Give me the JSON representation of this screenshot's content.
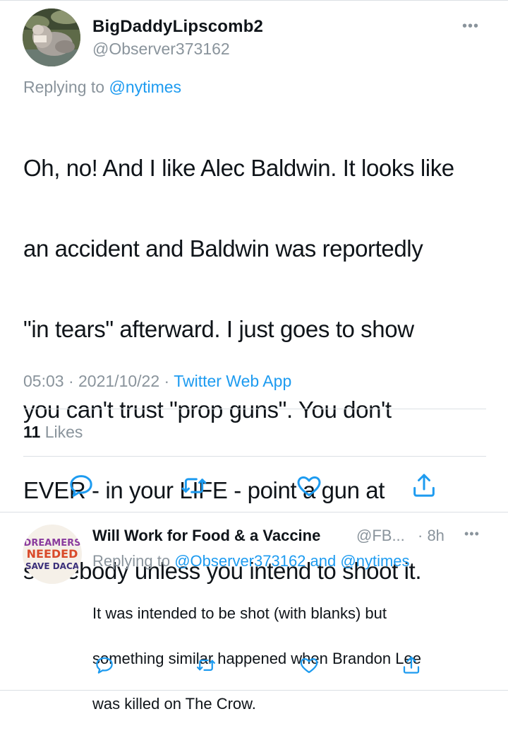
{
  "main_tweet": {
    "display_name": "BigDaddyLipscomb2",
    "handle": "@Observer373162",
    "more_icon": "more-horizontal-icon",
    "replying_prefix": "Replying to",
    "replying_to": "@nytimes",
    "body_lines": [
      "Oh, no! And I like Alec Baldwin.  It looks like",
      "an accident and Baldwin was reportedly",
      "\"in tears\" afterward.   I just goes to show",
      "you can't trust \"prop guns\". You don't",
      "EVER - in your LIFE - point a gun at",
      "somebody unless you intend to shoot it."
    ],
    "time": "05:03",
    "date": "2021/10/22",
    "source": "Twitter Web App",
    "separator": "·",
    "likes_count": "11",
    "likes_label": "Likes",
    "actions": [
      "reply-icon",
      "retweet-icon",
      "like-icon",
      "share-icon"
    ]
  },
  "reply_tweet": {
    "display_name": "Will Work for Food & a Vaccine",
    "handle": "@FB...",
    "time": "· 8h",
    "more_icon": "more-horizontal-icon",
    "avatar_text": [
      "DREAMERS",
      "NEEDED",
      "SAVE DACA"
    ],
    "replying_prefix": "Replying to",
    "replying_to_1": "@Observer373162",
    "and_text": "and",
    "replying_to_2": "@nytimes",
    "body_lines": [
      "It was intended to be shot (with blanks) but",
      "something similar happened when Brandon Lee",
      "was killed on The Crow."
    ],
    "actions": [
      "reply-icon",
      "retweet-icon",
      "like-icon",
      "share-icon"
    ]
  },
  "colors": {
    "link": "#1d9bf0",
    "secondary_text": "#8a949c",
    "icon": "#1d9bf0",
    "divider": "#dbe0e4"
  }
}
